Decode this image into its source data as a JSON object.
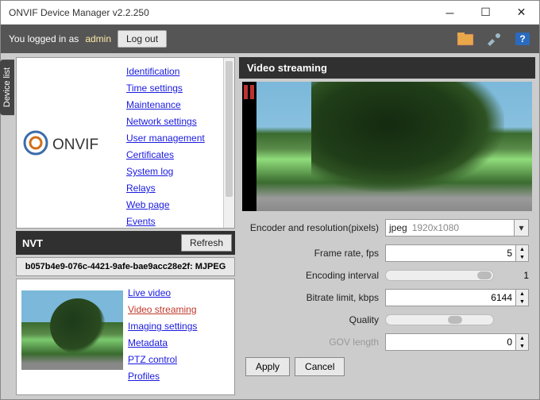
{
  "window": {
    "title": "ONVIF Device Manager v2.2.250"
  },
  "topbar": {
    "logged_in_text": "You logged in as",
    "username": "admin",
    "logout_label": "Log out"
  },
  "side_tab": "Device list",
  "left": {
    "links1": [
      "Identification",
      "Time settings",
      "Maintenance",
      "Network settings",
      "User management",
      "Certificates",
      "System log",
      "Relays",
      "Web page",
      "Events"
    ],
    "nvt_label": "NVT",
    "refresh_label": "Refresh",
    "device_id": "b057b4e9-076c-4421-9afe-bae9acc28e2f: MJPEG",
    "links2": [
      "Live video",
      "Video streaming",
      "Imaging settings",
      "Metadata",
      "PTZ control",
      "Profiles"
    ],
    "active_link_index": 1
  },
  "right": {
    "header": "Video streaming",
    "encoder_label": "Encoder and resolution(pixels)",
    "encoder_value": "jpeg",
    "resolution_value": "1920x1080",
    "framerate_label": "Frame rate, fps",
    "framerate_value": "5",
    "encoding_interval_label": "Encoding interval",
    "encoding_interval_value": "1",
    "bitrate_label": "Bitrate limit, kbps",
    "bitrate_value": "6144",
    "quality_label": "Quality",
    "gov_label": "GOV length",
    "gov_value": "0",
    "apply_label": "Apply",
    "cancel_label": "Cancel"
  }
}
